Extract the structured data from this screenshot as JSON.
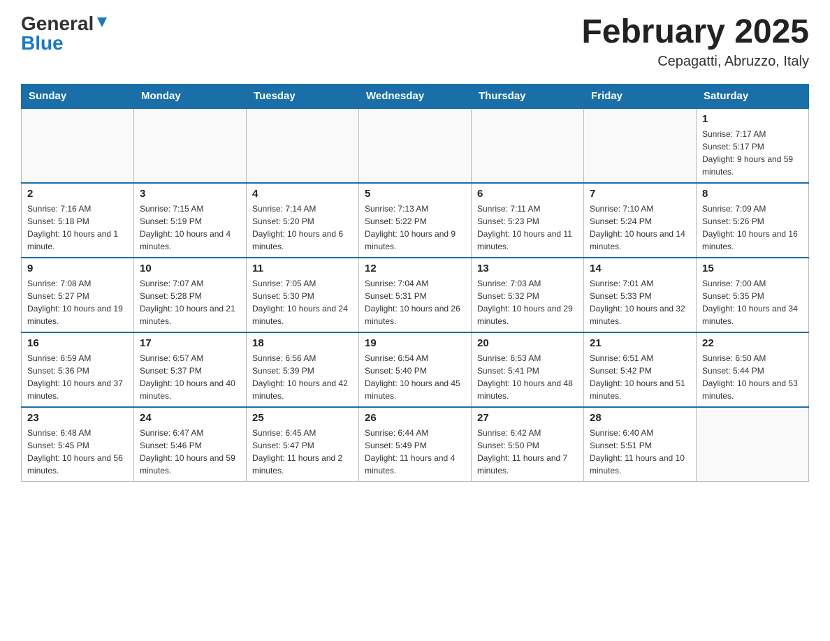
{
  "header": {
    "logo_general": "General",
    "logo_blue": "Blue",
    "title": "February 2025",
    "subtitle": "Cepagatti, Abruzzo, Italy"
  },
  "days_of_week": [
    "Sunday",
    "Monday",
    "Tuesday",
    "Wednesday",
    "Thursday",
    "Friday",
    "Saturday"
  ],
  "weeks": [
    [
      {
        "day": "",
        "info": ""
      },
      {
        "day": "",
        "info": ""
      },
      {
        "day": "",
        "info": ""
      },
      {
        "day": "",
        "info": ""
      },
      {
        "day": "",
        "info": ""
      },
      {
        "day": "",
        "info": ""
      },
      {
        "day": "1",
        "info": "Sunrise: 7:17 AM\nSunset: 5:17 PM\nDaylight: 9 hours and 59 minutes."
      }
    ],
    [
      {
        "day": "2",
        "info": "Sunrise: 7:16 AM\nSunset: 5:18 PM\nDaylight: 10 hours and 1 minute."
      },
      {
        "day": "3",
        "info": "Sunrise: 7:15 AM\nSunset: 5:19 PM\nDaylight: 10 hours and 4 minutes."
      },
      {
        "day": "4",
        "info": "Sunrise: 7:14 AM\nSunset: 5:20 PM\nDaylight: 10 hours and 6 minutes."
      },
      {
        "day": "5",
        "info": "Sunrise: 7:13 AM\nSunset: 5:22 PM\nDaylight: 10 hours and 9 minutes."
      },
      {
        "day": "6",
        "info": "Sunrise: 7:11 AM\nSunset: 5:23 PM\nDaylight: 10 hours and 11 minutes."
      },
      {
        "day": "7",
        "info": "Sunrise: 7:10 AM\nSunset: 5:24 PM\nDaylight: 10 hours and 14 minutes."
      },
      {
        "day": "8",
        "info": "Sunrise: 7:09 AM\nSunset: 5:26 PM\nDaylight: 10 hours and 16 minutes."
      }
    ],
    [
      {
        "day": "9",
        "info": "Sunrise: 7:08 AM\nSunset: 5:27 PM\nDaylight: 10 hours and 19 minutes."
      },
      {
        "day": "10",
        "info": "Sunrise: 7:07 AM\nSunset: 5:28 PM\nDaylight: 10 hours and 21 minutes."
      },
      {
        "day": "11",
        "info": "Sunrise: 7:05 AM\nSunset: 5:30 PM\nDaylight: 10 hours and 24 minutes."
      },
      {
        "day": "12",
        "info": "Sunrise: 7:04 AM\nSunset: 5:31 PM\nDaylight: 10 hours and 26 minutes."
      },
      {
        "day": "13",
        "info": "Sunrise: 7:03 AM\nSunset: 5:32 PM\nDaylight: 10 hours and 29 minutes."
      },
      {
        "day": "14",
        "info": "Sunrise: 7:01 AM\nSunset: 5:33 PM\nDaylight: 10 hours and 32 minutes."
      },
      {
        "day": "15",
        "info": "Sunrise: 7:00 AM\nSunset: 5:35 PM\nDaylight: 10 hours and 34 minutes."
      }
    ],
    [
      {
        "day": "16",
        "info": "Sunrise: 6:59 AM\nSunset: 5:36 PM\nDaylight: 10 hours and 37 minutes."
      },
      {
        "day": "17",
        "info": "Sunrise: 6:57 AM\nSunset: 5:37 PM\nDaylight: 10 hours and 40 minutes."
      },
      {
        "day": "18",
        "info": "Sunrise: 6:56 AM\nSunset: 5:39 PM\nDaylight: 10 hours and 42 minutes."
      },
      {
        "day": "19",
        "info": "Sunrise: 6:54 AM\nSunset: 5:40 PM\nDaylight: 10 hours and 45 minutes."
      },
      {
        "day": "20",
        "info": "Sunrise: 6:53 AM\nSunset: 5:41 PM\nDaylight: 10 hours and 48 minutes."
      },
      {
        "day": "21",
        "info": "Sunrise: 6:51 AM\nSunset: 5:42 PM\nDaylight: 10 hours and 51 minutes."
      },
      {
        "day": "22",
        "info": "Sunrise: 6:50 AM\nSunset: 5:44 PM\nDaylight: 10 hours and 53 minutes."
      }
    ],
    [
      {
        "day": "23",
        "info": "Sunrise: 6:48 AM\nSunset: 5:45 PM\nDaylight: 10 hours and 56 minutes."
      },
      {
        "day": "24",
        "info": "Sunrise: 6:47 AM\nSunset: 5:46 PM\nDaylight: 10 hours and 59 minutes."
      },
      {
        "day": "25",
        "info": "Sunrise: 6:45 AM\nSunset: 5:47 PM\nDaylight: 11 hours and 2 minutes."
      },
      {
        "day": "26",
        "info": "Sunrise: 6:44 AM\nSunset: 5:49 PM\nDaylight: 11 hours and 4 minutes."
      },
      {
        "day": "27",
        "info": "Sunrise: 6:42 AM\nSunset: 5:50 PM\nDaylight: 11 hours and 7 minutes."
      },
      {
        "day": "28",
        "info": "Sunrise: 6:40 AM\nSunset: 5:51 PM\nDaylight: 11 hours and 10 minutes."
      },
      {
        "day": "",
        "info": ""
      }
    ]
  ]
}
